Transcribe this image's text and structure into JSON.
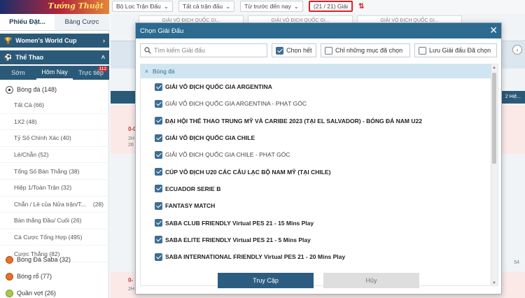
{
  "sidebar": {
    "brand_text": "Tướng Thuật",
    "top_tabs": [
      {
        "label": "Phiếu Đặt..."
      },
      {
        "label": "Bảng Cược"
      }
    ],
    "promo": "Women's World Cup",
    "section": "Thể Thao",
    "sub_tabs": [
      {
        "label": "Sớm"
      },
      {
        "label": "Hôm Nay"
      },
      {
        "label": "Trực tiếp"
      }
    ],
    "live_badge": "112",
    "football": "Bóng đá (148)",
    "football_items": [
      {
        "label": "Tất Cả (66)",
        "right": ""
      },
      {
        "label": "1X2 (48)",
        "right": ""
      },
      {
        "label": "Tỷ Số Chính Xác (40)",
        "right": ""
      },
      {
        "label": "Lẻ/Chẵn (52)",
        "right": ""
      },
      {
        "label": "Tổng Số Bàn Thắng (38)",
        "right": ""
      },
      {
        "label": "Hiệp 1/Toàn Trận (32)",
        "right": ""
      },
      {
        "label": "Chẵn / Lẻ của Nửa trận/T...",
        "right": "(28)"
      },
      {
        "label": "Bàn thắng Đầu/ Cuối (26)",
        "right": ""
      },
      {
        "label": "Cá Cược Tổng Hợp (495)",
        "right": ""
      },
      {
        "label": "Cược Thắng (82)",
        "right": ""
      }
    ],
    "other_sports": [
      {
        "label": "Bóng Đá Saba (32)"
      },
      {
        "label": "Bóng rổ (77)"
      },
      {
        "label": "Quần vợt (26)"
      }
    ]
  },
  "topbar": {
    "filters": [
      {
        "label": "Bộ Lọc Trận Đấu"
      },
      {
        "label": "Tất cả trận đấu"
      },
      {
        "label": "Từ trước đến nay"
      }
    ],
    "league_count": "(21 / 21) Giải"
  },
  "background": {
    "league_tab_text": "GIẢI VÔ ĐỊCH QUỐC GI...",
    "score1": "0-0",
    "score2": "0-",
    "half1": "2H",
    "half2": "26",
    "right_label": "2 Hiệ...",
    "right_num": "54"
  },
  "modal": {
    "title": "Chọn Giải Đấu",
    "search_placeholder": "Tìm kiếm Giải đấu",
    "select_all": "Chọn hết",
    "only_selected": "Chỉ những mục đã chọn",
    "save_selected": "Lưu Giải đấu Đã chọn",
    "group": "Bóng đá",
    "leagues": [
      {
        "name": "GIẢI VÔ ĐỊCH QUỐC GIA ARGENTINA",
        "bold": true
      },
      {
        "name": "GIẢI VÔ ĐỊCH QUỐC GIA ARGENTINA - PHẠT GÓC",
        "bold": false
      },
      {
        "name": "ĐẠI HỘI THỂ THAO TRUNG MỸ VÀ CARIBE 2023 (TẠI EL SALVADOR) - BÓNG ĐÁ NAM U22",
        "bold": true
      },
      {
        "name": "GIẢI VÔ ĐỊCH QUỐC GIA CHILE",
        "bold": true
      },
      {
        "name": "GIẢI VÔ ĐỊCH QUỐC GIA CHILE - PHẠT GÓC",
        "bold": false
      },
      {
        "name": "CÚP VÔ ĐỊCH U20 CÁC CÂU LẠC BỘ NAM MỸ (TẠI CHILE)",
        "bold": true
      },
      {
        "name": "ECUADOR SERIE B",
        "bold": true
      },
      {
        "name": "FANTASY MATCH",
        "bold": true
      },
      {
        "name": "SABA CLUB FRIENDLY Virtual PES 21 - 15 Mins Play",
        "bold": true
      },
      {
        "name": "SABA ELITE FRIENDLY Virtual PES 21 - 5 Mins Play",
        "bold": true
      },
      {
        "name": "SABA INTERNATIONAL FRIENDLY Virtual PES 21 - 20 Mins Play",
        "bold": true
      }
    ],
    "confirm": "Truy Cập",
    "cancel": "Hủy"
  },
  "colors": {
    "header_blue": "#2c6a8f",
    "sidebar_blue": "#2b5a78",
    "confirm_btn": "#2c5d81",
    "highlight_red": "#e01f26"
  }
}
